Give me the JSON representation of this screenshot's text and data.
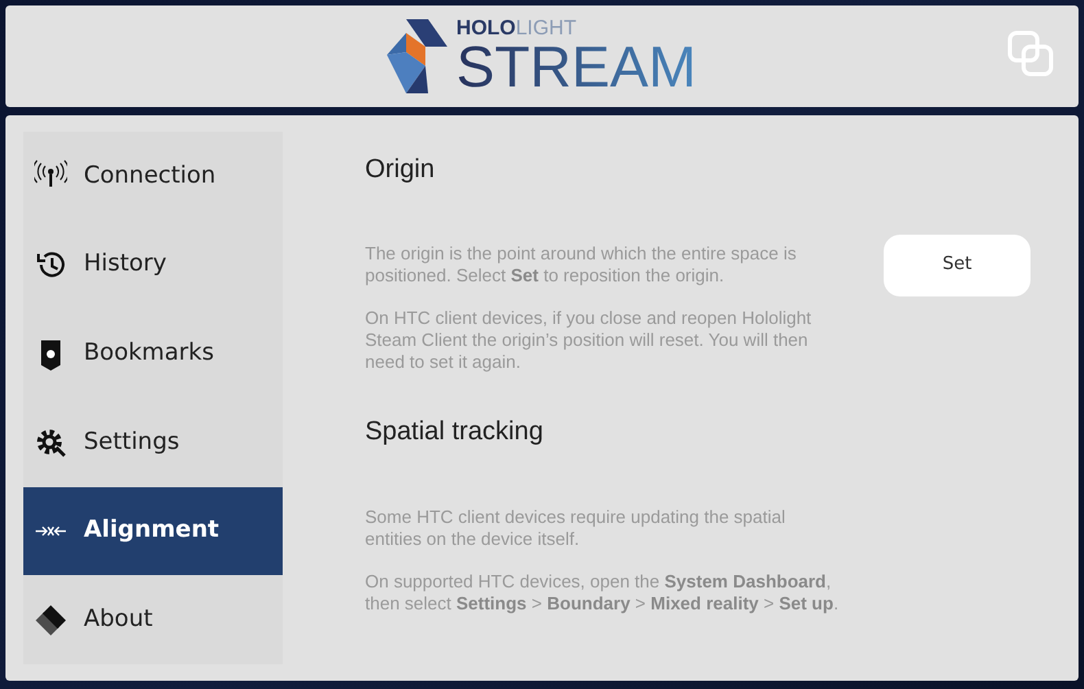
{
  "header": {
    "brand_top": "**HOLO**LIGHT",
    "brand_main": "STREAM"
  },
  "sidebar": {
    "items": [
      {
        "label": "Connection",
        "kind": "connection",
        "selected": false
      },
      {
        "label": "History",
        "kind": "history",
        "selected": false
      },
      {
        "label": "Bookmarks",
        "kind": "bookmarks",
        "selected": false
      },
      {
        "label": "Settings",
        "kind": "settings",
        "selected": false
      },
      {
        "label": "Alignment",
        "kind": "alignment",
        "selected": true
      },
      {
        "label": "About",
        "kind": "about",
        "selected": false
      }
    ]
  },
  "sections": [
    {
      "title": "Origin",
      "paragraphs": [
        "The origin is the point around which the entire space is positioned. Select **Set** to reposition the origin.",
        "On HTC client devices, if you close and reopen Hololight Steam Client the origin’s position will reset. You will then need to set it again."
      ],
      "button": "Set"
    },
    {
      "title": "Spatial tracking",
      "paragraphs": [
        "Some HTC client devices require updating the spatial entities on the device itself.",
        "On supported HTC devices, open the **System Dashboard**, then select **Settings** > **Boundary** > **Mixed reality** > **Set up**."
      ]
    }
  ]
}
